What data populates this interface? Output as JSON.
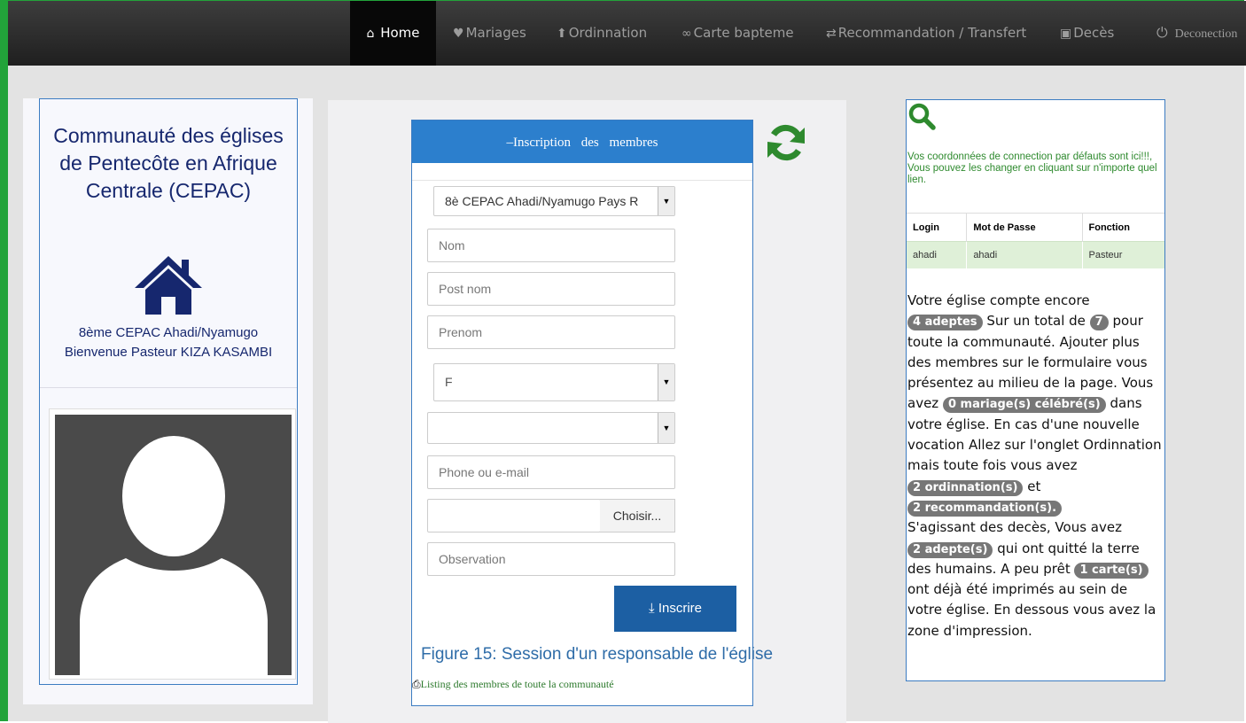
{
  "nav": {
    "items": [
      {
        "label": "Home",
        "icon": "home-icon"
      },
      {
        "label": "Mariages",
        "icon": "heart-icon"
      },
      {
        "label": "Ordinnation",
        "icon": "upload-icon"
      },
      {
        "label": "Carte bapteme",
        "icon": "paperclip-icon"
      },
      {
        "label": "Recommandation / Transfert",
        "icon": "transfer-icon"
      },
      {
        "label": "Decès",
        "icon": "cart-icon"
      },
      {
        "label": "Deconection",
        "icon": "power-icon"
      }
    ]
  },
  "left": {
    "org_title": "Communauté des églises de Pentecôte en Afrique Centrale (CEPAC)",
    "parish": "8ème CEPAC Ahadi/Nyamugo",
    "welcome": "Bienvenue Pasteur KIZA KASAMBI"
  },
  "form": {
    "header": "Inscription des membres",
    "church_select": "8è CEPAC Ahadi/Nyamugo Pays R",
    "nom_placeholder": "Nom",
    "postnom_placeholder": "Post nom",
    "prenom_placeholder": "Prenom",
    "sex_select": "F",
    "second_select": "",
    "phone_placeholder": "Phone ou e-mail",
    "file_button": "Choisir...",
    "observation_placeholder": "Observation",
    "submit_label": "Inscrire"
  },
  "caption": "Figure 15: Session d'un responsable de l'église",
  "listing_link": "Listing des membres de toute la communauté",
  "right": {
    "cred_note": "Vos coordonnées de connection par défauts sont ici!!!, Vous pouvez les changer en cliquant sur n'importe quel lien.",
    "table": {
      "headers": [
        "Login",
        "Mot de Passe",
        "Fonction"
      ],
      "rows": [
        [
          "ahadi",
          "ahadi",
          "Pasteur"
        ]
      ]
    },
    "stats": {
      "t1": "Votre église compte encore",
      "b1": "4 adeptes",
      "t2": "Sur un total de",
      "b2": "7",
      "t3": "pour toute la communauté. Ajouter plus des membres sur le formulaire vous présentez au milieu de la page. Vous avez",
      "b3": "0 mariage(s) célébré(s)",
      "t4": "dans votre église. En cas d'une nouvelle vocation Allez sur l'onglet Ordinnation mais toute fois vous avez",
      "b4": "2 ordinnation(s)",
      "t5": "et",
      "b5": "2 recommandation(s).",
      "t6": "S'agissant des decès, Vous avez",
      "b6": "2 adepte(s)",
      "t7": "qui ont quitté la terre des humains. A peu prêt",
      "b7": "1 carte(s)",
      "t8": "ont déjà été imprimés au sein de votre église. En dessous vous avez la zone d'impression."
    }
  },
  "colors": {
    "accent": "#2c7fcd",
    "submit": "#1c5fa3",
    "title_text": "#16276e",
    "refresh": "#2e8a2e",
    "frame_border": "#22a33a"
  }
}
